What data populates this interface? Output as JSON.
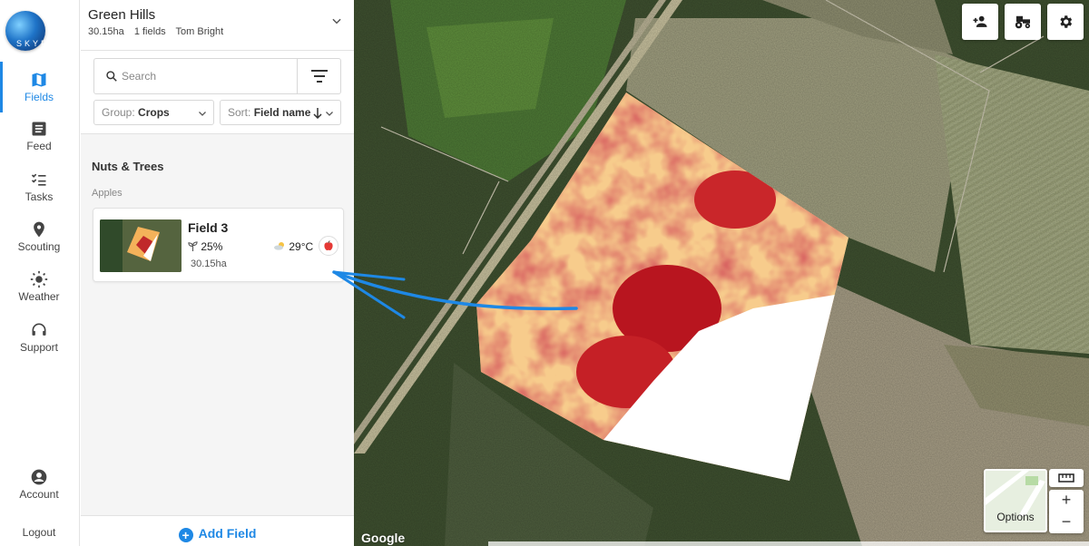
{
  "brand": {
    "logo_text": "SKYFLD"
  },
  "nav": {
    "items": [
      {
        "label": "Fields",
        "icon": "map-icon",
        "active": true
      },
      {
        "label": "Feed",
        "icon": "feed-icon"
      },
      {
        "label": "Tasks",
        "icon": "tasks-icon"
      },
      {
        "label": "Scouting",
        "icon": "pin-icon"
      },
      {
        "label": "Weather",
        "icon": "sun-icon"
      },
      {
        "label": "Support",
        "icon": "headset-icon"
      }
    ],
    "account_label": "Account",
    "logout_label": "Logout"
  },
  "farm": {
    "name": "Green Hills",
    "area": "30.15ha",
    "fields_count": "1 fields",
    "owner": "Tom Bright"
  },
  "controls": {
    "search_placeholder": "Search",
    "group_prefix": "Group: ",
    "group_value": "Crops",
    "sort_prefix": "Sort: ",
    "sort_value": "Field name"
  },
  "list": {
    "group_title": "Nuts & Trees",
    "sub_title": "Apples",
    "fields": [
      {
        "name": "Field 3",
        "ndvi": "25%",
        "area": "30.15ha",
        "temperature": "29°C",
        "crop_icon": "apple-icon"
      }
    ]
  },
  "add_field_label": "Add Field",
  "map": {
    "options_label": "Options",
    "zoom_in": "+",
    "zoom_out": "−",
    "provider": "Google",
    "accent": "#1e88e5"
  }
}
